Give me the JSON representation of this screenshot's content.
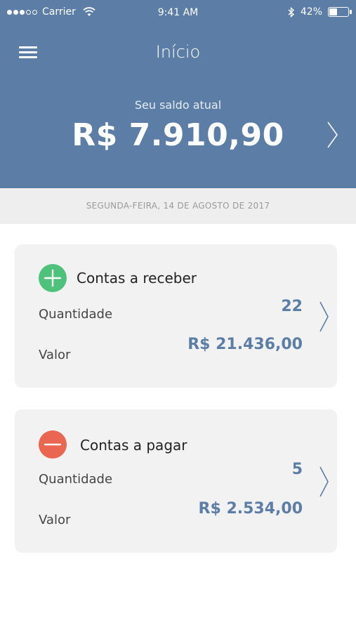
{
  "status_bar": {
    "carrier": "Carrier",
    "time": "9:41 AM",
    "battery": "42%",
    "battery_level": 0.42
  },
  "nav": {
    "title": "Início",
    "menu_icon": "hamburger-menu-icon"
  },
  "balance": {
    "label": "Seu saldo atual",
    "value": "R$ 7.910,90"
  },
  "date": "SEGUNDA-FEIRA, 14 DE AGOSTO DE 2017",
  "cards": {
    "receive": {
      "title": "Contas a receber",
      "icon": "plus-circle-icon",
      "quantity_label": "Quantidade",
      "quantity": "22",
      "value_label": "Valor",
      "value": "R$ 21.436,00"
    },
    "pay": {
      "title": "Contas a pagar",
      "icon": "minus-circle-icon",
      "quantity_label": "Quantidade",
      "quantity": "5",
      "value_label": "Valor",
      "value": "R$ 2.534,00"
    }
  },
  "colors": {
    "header": "#5b7da6",
    "positive": "#4ec27a",
    "negative": "#eb6650",
    "value_text": "#5b7da6"
  }
}
